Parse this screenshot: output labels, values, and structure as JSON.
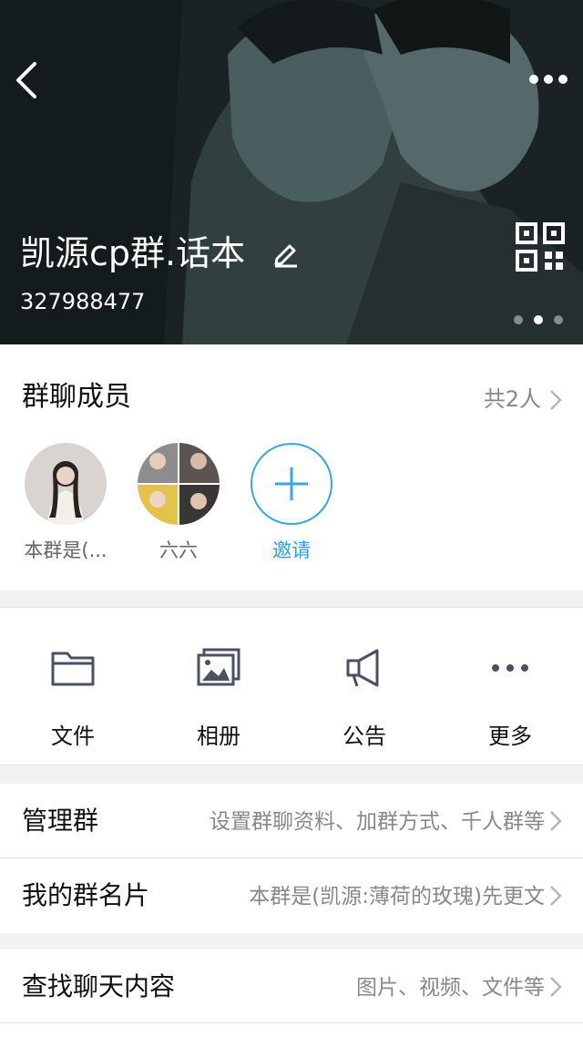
{
  "header": {
    "group_name": "凯源cp群.话本",
    "group_id": "327988477",
    "carousel_total": 3,
    "carousel_active_index": 1
  },
  "members": {
    "title": "群聊成员",
    "count_label": "共2人",
    "list": [
      {
        "label": "本群是(..."
      },
      {
        "label": "六六"
      }
    ],
    "invite_label": "邀请"
  },
  "actions": [
    {
      "label": "文件",
      "icon": "folder-icon"
    },
    {
      "label": "相册",
      "icon": "album-icon"
    },
    {
      "label": "公告",
      "icon": "announcement-icon"
    },
    {
      "label": "更多",
      "icon": "more-dots-icon"
    }
  ],
  "settings": [
    {
      "label": "管理群",
      "value": "设置群聊资料、加群方式、千人群等"
    },
    {
      "label": "我的群名片",
      "value": "本群是(凯源:薄荷的玫瑰)先更文"
    },
    {
      "label": "查找聊天内容",
      "value": "图片、视频、文件等"
    }
  ],
  "colors": {
    "accent": "#38a6e0",
    "secondary_text": "#888888",
    "background": "#f2f2f5"
  }
}
